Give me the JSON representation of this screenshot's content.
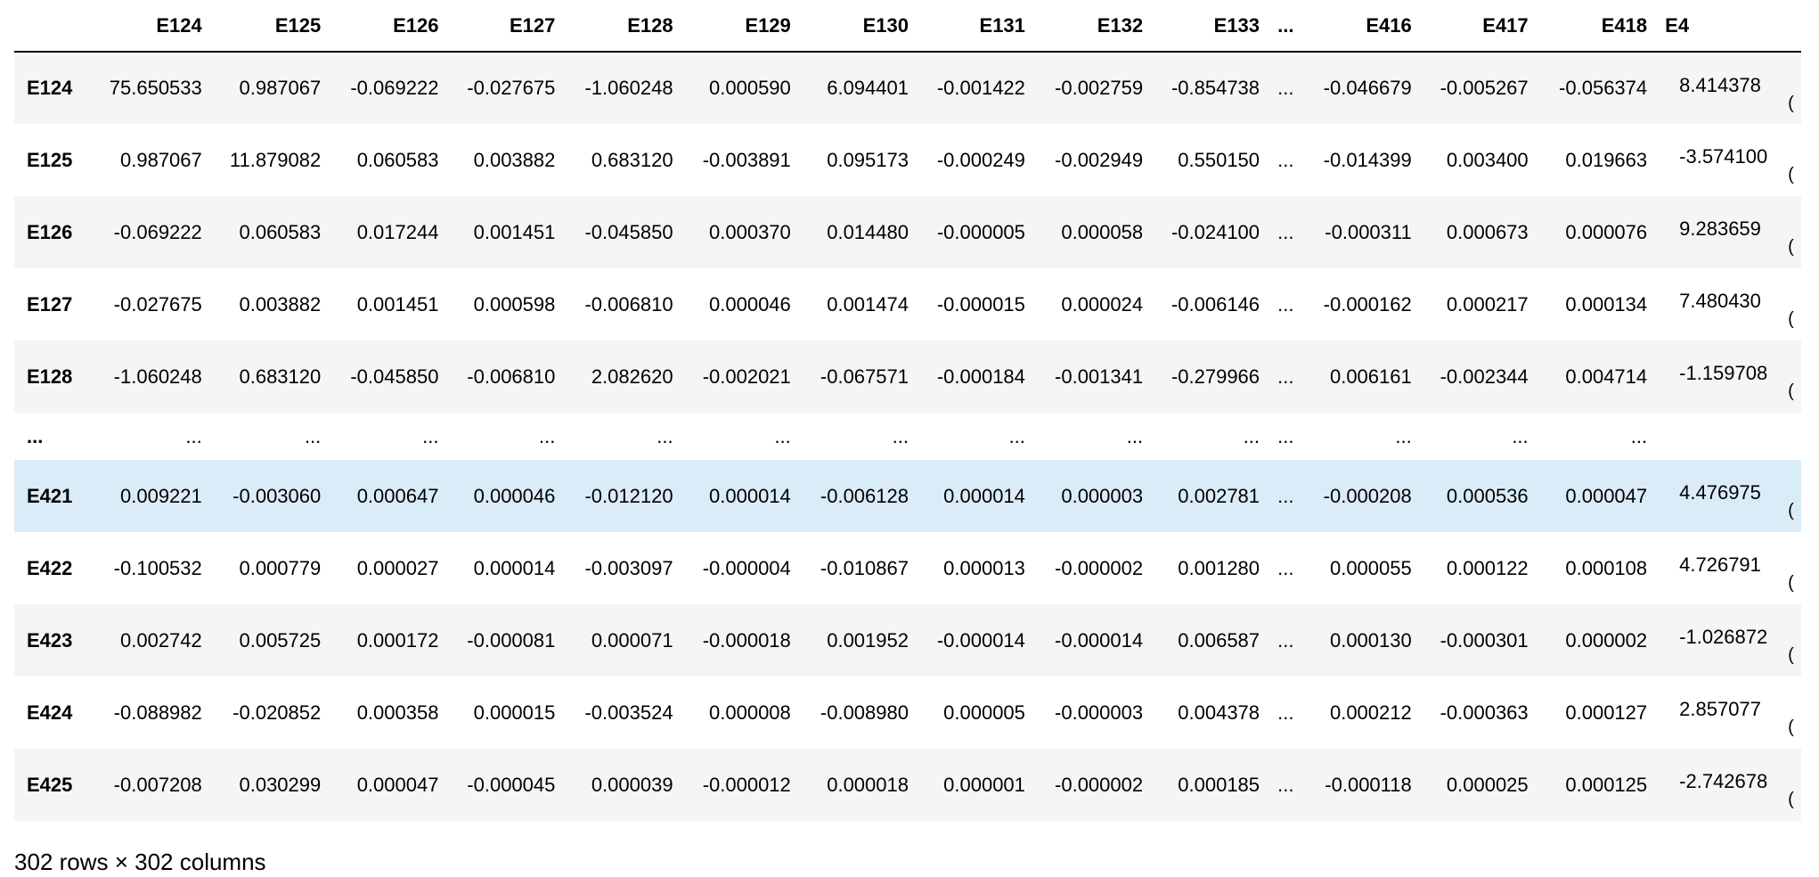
{
  "dataframe": {
    "columns": [
      "E124",
      "E125",
      "E126",
      "E127",
      "E128",
      "E129",
      "E130",
      "E131",
      "E132",
      "E133",
      "...",
      "E416",
      "E417",
      "E418",
      "E4"
    ],
    "rows": [
      {
        "label": "E124",
        "cells": [
          "75.650533",
          "0.987067",
          "-0.069222",
          "-0.027675",
          "-1.060248",
          "0.000590",
          "6.094401",
          "-0.001422",
          "-0.002759",
          "-0.854738",
          "...",
          "-0.046679",
          "-0.005267",
          "-0.056374",
          "8.414378"
        ]
      },
      {
        "label": "E125",
        "cells": [
          "0.987067",
          "11.879082",
          "0.060583",
          "0.003882",
          "0.683120",
          "-0.003891",
          "0.095173",
          "-0.000249",
          "-0.002949",
          "0.550150",
          "...",
          "-0.014399",
          "0.003400",
          "0.019663",
          "-3.574100"
        ]
      },
      {
        "label": "E126",
        "cells": [
          "-0.069222",
          "0.060583",
          "0.017244",
          "0.001451",
          "-0.045850",
          "0.000370",
          "0.014480",
          "-0.000005",
          "0.000058",
          "-0.024100",
          "...",
          "-0.000311",
          "0.000673",
          "0.000076",
          "9.283659"
        ]
      },
      {
        "label": "E127",
        "cells": [
          "-0.027675",
          "0.003882",
          "0.001451",
          "0.000598",
          "-0.006810",
          "0.000046",
          "0.001474",
          "-0.000015",
          "0.000024",
          "-0.006146",
          "...",
          "-0.000162",
          "0.000217",
          "0.000134",
          "7.480430"
        ]
      },
      {
        "label": "E128",
        "cells": [
          "-1.060248",
          "0.683120",
          "-0.045850",
          "-0.006810",
          "2.082620",
          "-0.002021",
          "-0.067571",
          "-0.000184",
          "-0.001341",
          "-0.279966",
          "...",
          "0.006161",
          "-0.002344",
          "0.004714",
          "-1.159708"
        ]
      },
      {
        "label": "...",
        "cells": [
          "...",
          "...",
          "...",
          "...",
          "...",
          "...",
          "...",
          "...",
          "...",
          "...",
          "...",
          "...",
          "...",
          "...",
          ""
        ]
      },
      {
        "label": "E421",
        "cells": [
          "0.009221",
          "-0.003060",
          "0.000647",
          "0.000046",
          "-0.012120",
          "0.000014",
          "-0.006128",
          "0.000014",
          "0.000003",
          "0.002781",
          "...",
          "-0.000208",
          "0.000536",
          "0.000047",
          "4.476975"
        ]
      },
      {
        "label": "E422",
        "cells": [
          "-0.100532",
          "0.000779",
          "0.000027",
          "0.000014",
          "-0.003097",
          "-0.000004",
          "-0.010867",
          "0.000013",
          "-0.000002",
          "0.001280",
          "...",
          "0.000055",
          "0.000122",
          "0.000108",
          "4.726791"
        ]
      },
      {
        "label": "E423",
        "cells": [
          "0.002742",
          "0.005725",
          "0.000172",
          "-0.000081",
          "0.000071",
          "-0.000018",
          "0.001952",
          "-0.000014",
          "-0.000014",
          "0.006587",
          "...",
          "0.000130",
          "-0.000301",
          "0.000002",
          "-1.026872"
        ]
      },
      {
        "label": "E424",
        "cells": [
          "-0.088982",
          "-0.020852",
          "0.000358",
          "0.000015",
          "-0.003524",
          "0.000008",
          "-0.008980",
          "0.000005",
          "-0.000003",
          "0.004378",
          "...",
          "0.000212",
          "-0.000363",
          "0.000127",
          "2.857077"
        ]
      },
      {
        "label": "E425",
        "cells": [
          "-0.007208",
          "0.030299",
          "0.000047",
          "-0.000045",
          "0.000039",
          "-0.000012",
          "0.000018",
          "0.000001",
          "-0.000002",
          "0.000185",
          "...",
          "-0.000118",
          "0.000025",
          "0.000125",
          "-2.742678"
        ]
      }
    ],
    "cut_subscript": "(",
    "highlighted_row": "E421",
    "shape_text": "302 rows × 302 columns"
  },
  "colors": {
    "row_stripe": "#f5f5f5",
    "row_hover": "#dbecf9",
    "header_border": "#000000"
  }
}
